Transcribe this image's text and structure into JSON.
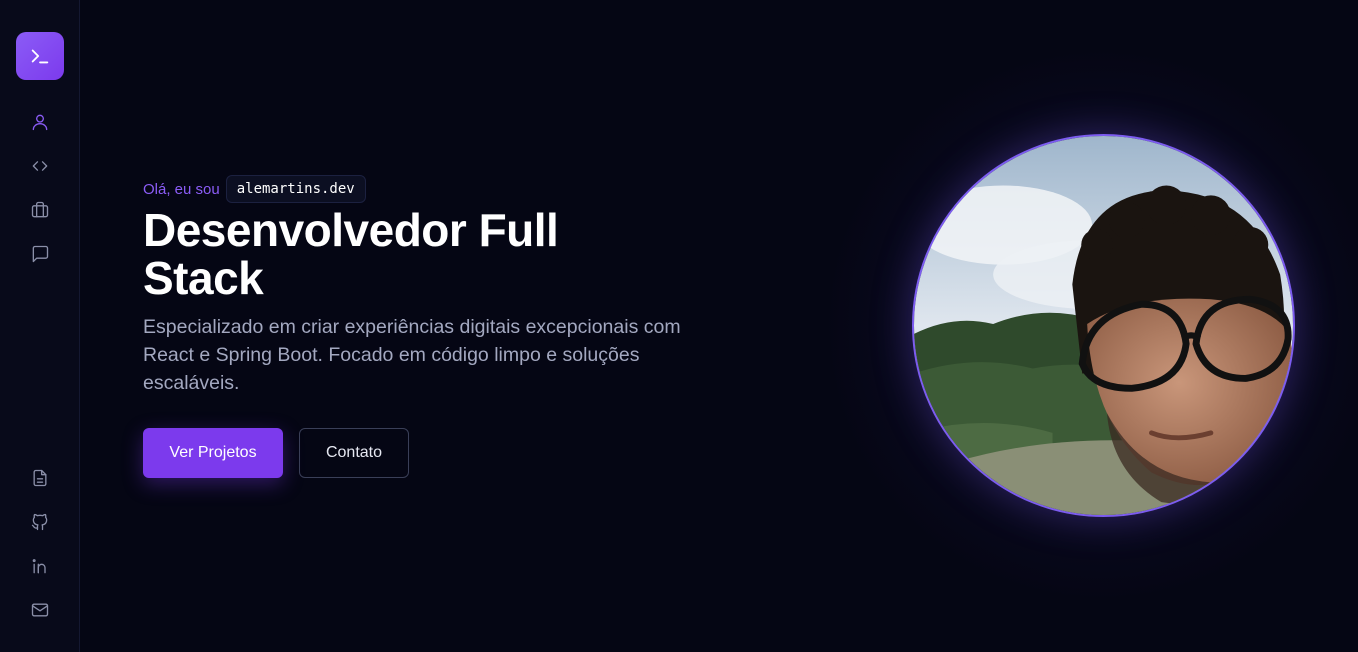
{
  "sidebar": {
    "logo_icon": "terminal-icon",
    "nav_items": [
      {
        "icon": "user-icon",
        "active": true
      },
      {
        "icon": "code-icon",
        "active": false
      },
      {
        "icon": "briefcase-icon",
        "active": false
      },
      {
        "icon": "message-icon",
        "active": false
      }
    ],
    "bottom_items": [
      {
        "icon": "document-icon"
      },
      {
        "icon": "github-icon"
      },
      {
        "icon": "linkedin-icon"
      },
      {
        "icon": "mail-icon"
      }
    ]
  },
  "hero": {
    "greeting": "Olá, eu sou",
    "handle": "alemartins.dev",
    "headline": "Desenvolvedor Full Stack",
    "subtitle": "Especializado em criar experiências digitais excepcionais com React e Spring Boot. Focado em código limpo e soluções escaláveis.",
    "primary_button": "Ver Projetos",
    "secondary_button": "Contato"
  },
  "colors": {
    "accent": "#7c3aed",
    "accent_light": "#8b5cf6",
    "background": "#050614",
    "sidebar": "#080a1a"
  }
}
